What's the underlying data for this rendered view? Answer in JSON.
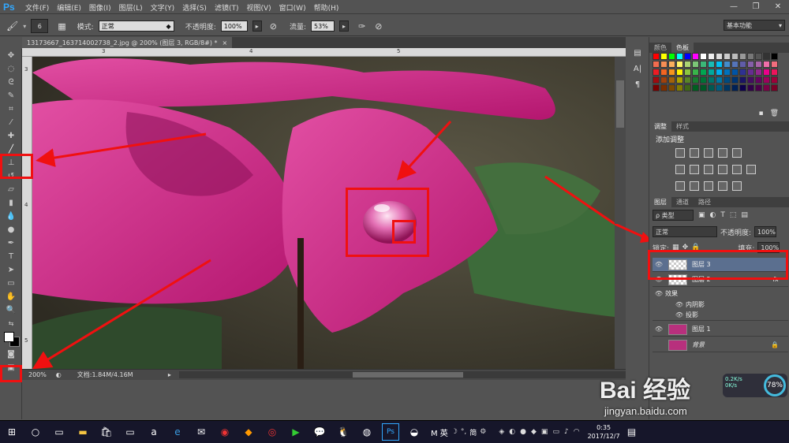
{
  "app": {
    "logo": "Ps",
    "window_controls": [
      "—",
      "❐",
      "✕"
    ]
  },
  "menu": [
    "文件(F)",
    "编辑(E)",
    "图像(I)",
    "图层(L)",
    "文字(Y)",
    "选择(S)",
    "滤镜(T)",
    "视图(V)",
    "窗口(W)",
    "帮助(H)"
  ],
  "options": {
    "brush_size": "6",
    "mode_label": "模式:",
    "mode_value": "正常",
    "opacity_label": "不透明度:",
    "opacity_value": "100%",
    "flow_label": "流量:",
    "flow_value": "53%",
    "workspace": "基本功能"
  },
  "document": {
    "tab_title": "13173667_163714002738_2.jpg @ 200% (图层 3, RGB/8#) *",
    "tab_close": "×",
    "zoom": "200%",
    "doc_info": "文档:1.84M/4.16M",
    "ruler_h": [
      "3",
      "4",
      "5"
    ],
    "ruler_v": [
      "3",
      "4",
      "5"
    ]
  },
  "panels": {
    "top_tabs": [
      "颜色",
      "色板"
    ],
    "adjust_tabs": [
      "调整",
      "样式"
    ],
    "adjust_title": "添加调整",
    "layers_tabs": [
      "图层",
      "通道",
      "路径"
    ],
    "filter_label": "ρ 类型",
    "blend_mode": "正常",
    "opacity_label": "不透明度:",
    "opacity_value": "100%",
    "lock_label": "锁定:",
    "fill_label": "填充:",
    "fill_value": "100%",
    "layers": [
      {
        "name": "图层 3"
      },
      {
        "name": "图层 2",
        "fx": "fx"
      },
      {
        "name": "效果"
      },
      {
        "name": "内阴影"
      },
      {
        "name": "投影"
      },
      {
        "name": "图层 1"
      },
      {
        "name": "背景"
      }
    ]
  },
  "net_widget": {
    "up": "0.2K/s",
    "down": "0K/s",
    "percent": "78%"
  },
  "watermark": {
    "brand": "Bai 经验",
    "url": "jingyan.baidu.com"
  },
  "taskbar": {
    "ime": "M 英",
    "ime_extra": "简",
    "time": "0:35",
    "date": "2017/12/7"
  },
  "colors": {
    "accent": "#31a8ff",
    "annotation": "#f01010",
    "petal": "#d6338f",
    "leaf": "#3d6b3a"
  }
}
